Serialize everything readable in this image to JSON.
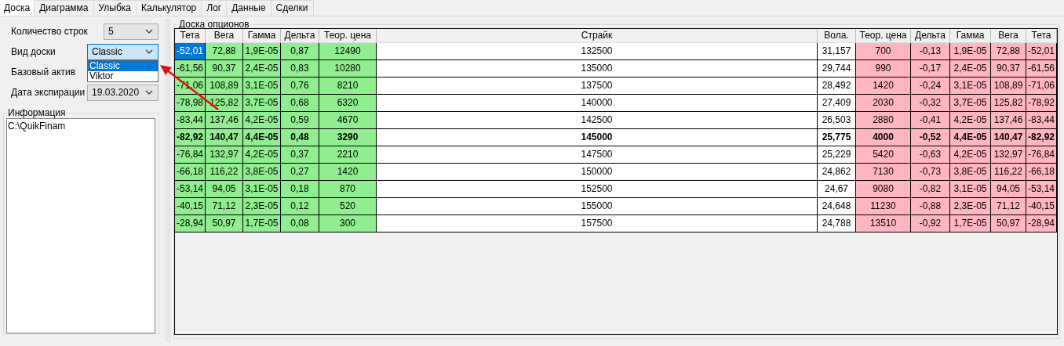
{
  "tabs": [
    {
      "label": "Доска",
      "selected": true
    },
    {
      "label": "Диаграмма",
      "selected": false
    },
    {
      "label": "Улыбка",
      "selected": false
    },
    {
      "label": "Калькулятор",
      "selected": false
    },
    {
      "label": "Лог",
      "selected": false
    },
    {
      "label": "Данные",
      "selected": false
    },
    {
      "label": "Сделки",
      "selected": false
    }
  ],
  "settings": {
    "rows_count": {
      "label": "Количество строк",
      "value": "5"
    },
    "board_view": {
      "label": "Вид доски",
      "value": "Classic",
      "expanded": true,
      "options": [
        {
          "label": "Classic",
          "selected": true
        },
        {
          "label": "Viktor",
          "selected": false
        }
      ]
    },
    "base_asset": {
      "label": "Базовый актив"
    },
    "expiration": {
      "label": "Дата экспирации",
      "value": "19.03.2020"
    }
  },
  "info": {
    "title": "Информация",
    "text": "C:\\QuikFinam"
  },
  "board": {
    "title": "Доска опционов",
    "columns": [
      {
        "label": "Тета",
        "kind": "call"
      },
      {
        "label": "Вега",
        "kind": "call"
      },
      {
        "label": "Гамма",
        "kind": "call"
      },
      {
        "label": "Дельта",
        "kind": "call"
      },
      {
        "label": "Теор. цена",
        "kind": "call"
      },
      {
        "label": "Страйк",
        "kind": "strike"
      },
      {
        "label": "Вола.",
        "kind": "strike"
      },
      {
        "label": "Теор. цена",
        "kind": "put"
      },
      {
        "label": "Дельта",
        "kind": "put"
      },
      {
        "label": "Гамма",
        "kind": "put"
      },
      {
        "label": "Вега",
        "kind": "put"
      },
      {
        "label": "Тета",
        "kind": "put"
      }
    ],
    "rows": [
      {
        "cells": [
          "-52,01",
          "72,88",
          "1,9E-05",
          "0,87",
          "12490",
          "132500",
          "31,157",
          "700",
          "-0,13",
          "1,9E-05",
          "72,88",
          "-52,01"
        ],
        "bold": false,
        "selected": true
      },
      {
        "cells": [
          "-61,56",
          "90,37",
          "2,4E-05",
          "0,83",
          "10280",
          "135000",
          "29,744",
          "990",
          "-0,17",
          "2,4E-05",
          "90,37",
          "-61,56"
        ],
        "bold": false,
        "selected": false
      },
      {
        "cells": [
          "-71,06",
          "108,89",
          "3,1E-05",
          "0,76",
          "8210",
          "137500",
          "28,492",
          "1420",
          "-0,24",
          "3,1E-05",
          "108,89",
          "-71,06"
        ],
        "bold": false,
        "selected": false
      },
      {
        "cells": [
          "-78,98",
          "125,82",
          "3,7E-05",
          "0,68",
          "6320",
          "140000",
          "27,409",
          "2030",
          "-0,32",
          "3,7E-05",
          "125,82",
          "-78,92"
        ],
        "bold": false,
        "selected": false
      },
      {
        "cells": [
          "-83,44",
          "137,46",
          "4,2E-05",
          "0,59",
          "4670",
          "142500",
          "26,503",
          "2880",
          "-0,41",
          "4,2E-05",
          "137,46",
          "-83,44"
        ],
        "bold": false,
        "selected": false
      },
      {
        "cells": [
          "-82,92",
          "140,47",
          "4,4E-05",
          "0,48",
          "3290",
          "145000",
          "25,775",
          "4000",
          "-0,52",
          "4,4E-05",
          "140,47",
          "-82,92"
        ],
        "bold": true,
        "selected": false
      },
      {
        "cells": [
          "-76,84",
          "132,97",
          "4,2E-05",
          "0,37",
          "2210",
          "147500",
          "25,229",
          "5420",
          "-0,63",
          "4,2E-05",
          "132,97",
          "-76,84"
        ],
        "bold": false,
        "selected": false
      },
      {
        "cells": [
          "-66,18",
          "116,22",
          "3,8E-05",
          "0,27",
          "1420",
          "150000",
          "24,862",
          "7130",
          "-0,73",
          "3,8E-05",
          "116,22",
          "-66,18"
        ],
        "bold": false,
        "selected": false
      },
      {
        "cells": [
          "-53,14",
          "94,05",
          "3,1E-05",
          "0,18",
          "870",
          "152500",
          "24,67",
          "9080",
          "-0,82",
          "3,1E-05",
          "94,05",
          "-53,14"
        ],
        "bold": false,
        "selected": false
      },
      {
        "cells": [
          "-40,15",
          "71,12",
          "2,3E-05",
          "0,12",
          "520",
          "155000",
          "24,648",
          "11230",
          "-0,88",
          "2,3E-05",
          "71,12",
          "-40,15"
        ],
        "bold": false,
        "selected": false
      },
      {
        "cells": [
          "-28,94",
          "50,97",
          "1,7E-05",
          "0,08",
          "300",
          "157500",
          "24,788",
          "13510",
          "-0,92",
          "1,7E-05",
          "50,97",
          "-28,94"
        ],
        "bold": false,
        "selected": false
      }
    ]
  }
}
